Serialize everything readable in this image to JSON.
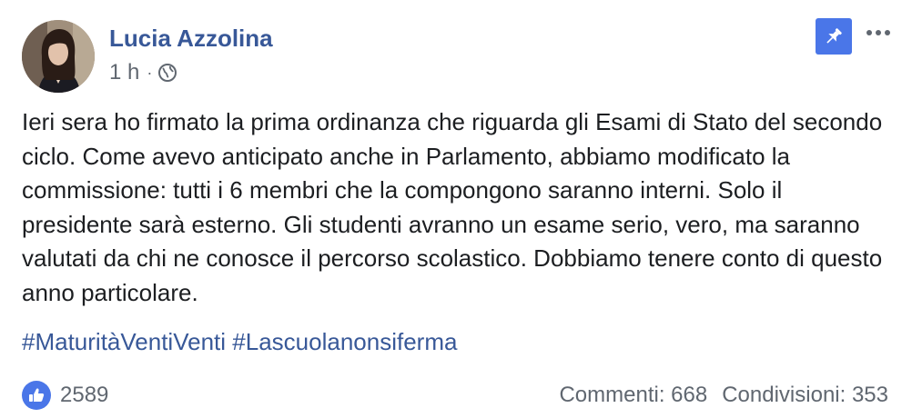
{
  "post": {
    "author": "Lucia Azzolina",
    "time": "1 h",
    "separator": "·",
    "audience_icon": "globe-icon",
    "pin_icon": "pushpin-icon",
    "more_icon": "more-dots-icon",
    "text": "Ieri sera ho firmato la prima ordinanza che riguarda gli Esami di Stato del secondo ciclo. Come avevo anticipato anche in Parlamento, abbiamo modificato la commissione: tutti i 6 membri che la compongono saranno interni. Solo il presidente sarà esterno. Gli studenti avranno un esame serio, vero, ma saranno valutati da chi ne conosce il percorso scolastico. Dobbiamo tenere conto di questo anno particolare.",
    "hashtags": [
      "#MaturitàVentiVenti",
      "#Lascuolanonsiferma"
    ],
    "reactions": {
      "icon": "thumbs-up-icon",
      "count": "2589"
    },
    "comments": "Commenti: 668",
    "shares": "Condivisioni: 353"
  },
  "colors": {
    "link": "#385898",
    "accent": "#4a76e8",
    "secondary_text": "#606770",
    "body_text": "#1c1e21"
  }
}
